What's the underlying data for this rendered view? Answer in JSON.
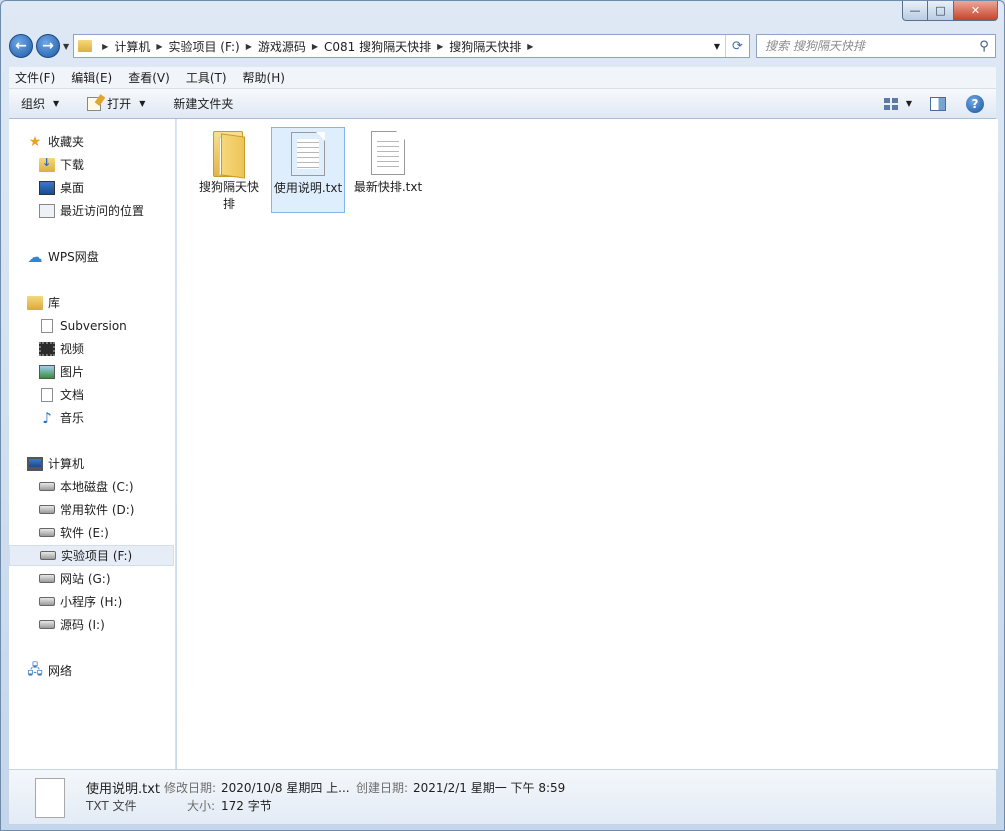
{
  "window": {
    "minimize_glyph": "—",
    "maximize_glyph": "□",
    "close_glyph": "✕"
  },
  "nav": {
    "back_glyph": "←",
    "forward_glyph": "→"
  },
  "address": {
    "crumbs": [
      "计算机",
      "实验项目 (F:)",
      "游戏源码",
      "C081 搜狗隔天快排",
      "搜狗隔天快排"
    ]
  },
  "search": {
    "placeholder": "搜索 搜狗隔天快排"
  },
  "menubar": [
    "文件(F)",
    "编辑(E)",
    "查看(V)",
    "工具(T)",
    "帮助(H)"
  ],
  "commandbar": {
    "organize": "组织",
    "open": "打开",
    "new_folder": "新建文件夹",
    "help": "?"
  },
  "navpane": {
    "favorites": {
      "label": "收藏夹",
      "items": [
        "下载",
        "桌面",
        "最近访问的位置"
      ]
    },
    "wps": {
      "label": "WPS网盘"
    },
    "libraries": {
      "label": "库",
      "items": [
        "Subversion",
        "视频",
        "图片",
        "文档",
        "音乐"
      ]
    },
    "computer": {
      "label": "计算机",
      "items": [
        "本地磁盘 (C:)",
        "常用软件 (D:)",
        "软件 (E:)",
        "实验项目 (F:)",
        "网站 (G:)",
        "小程序 (H:)",
        "源码 (I:)"
      ]
    },
    "network": {
      "label": "网络"
    }
  },
  "files": [
    {
      "name": "搜狗隔天快排",
      "type": "folder"
    },
    {
      "name": "使用说明.txt",
      "type": "txt"
    },
    {
      "name": "最新快排.txt",
      "type": "txt"
    }
  ],
  "details": {
    "name": "使用说明.txt",
    "type": "TXT 文件",
    "modified_label": "修改日期:",
    "modified_value": "2020/10/8 星期四 上...",
    "created_label": "创建日期:",
    "created_value": "2021/2/1 星期一 下午 8:59",
    "size_label": "大小:",
    "size_value": "172 字节"
  }
}
